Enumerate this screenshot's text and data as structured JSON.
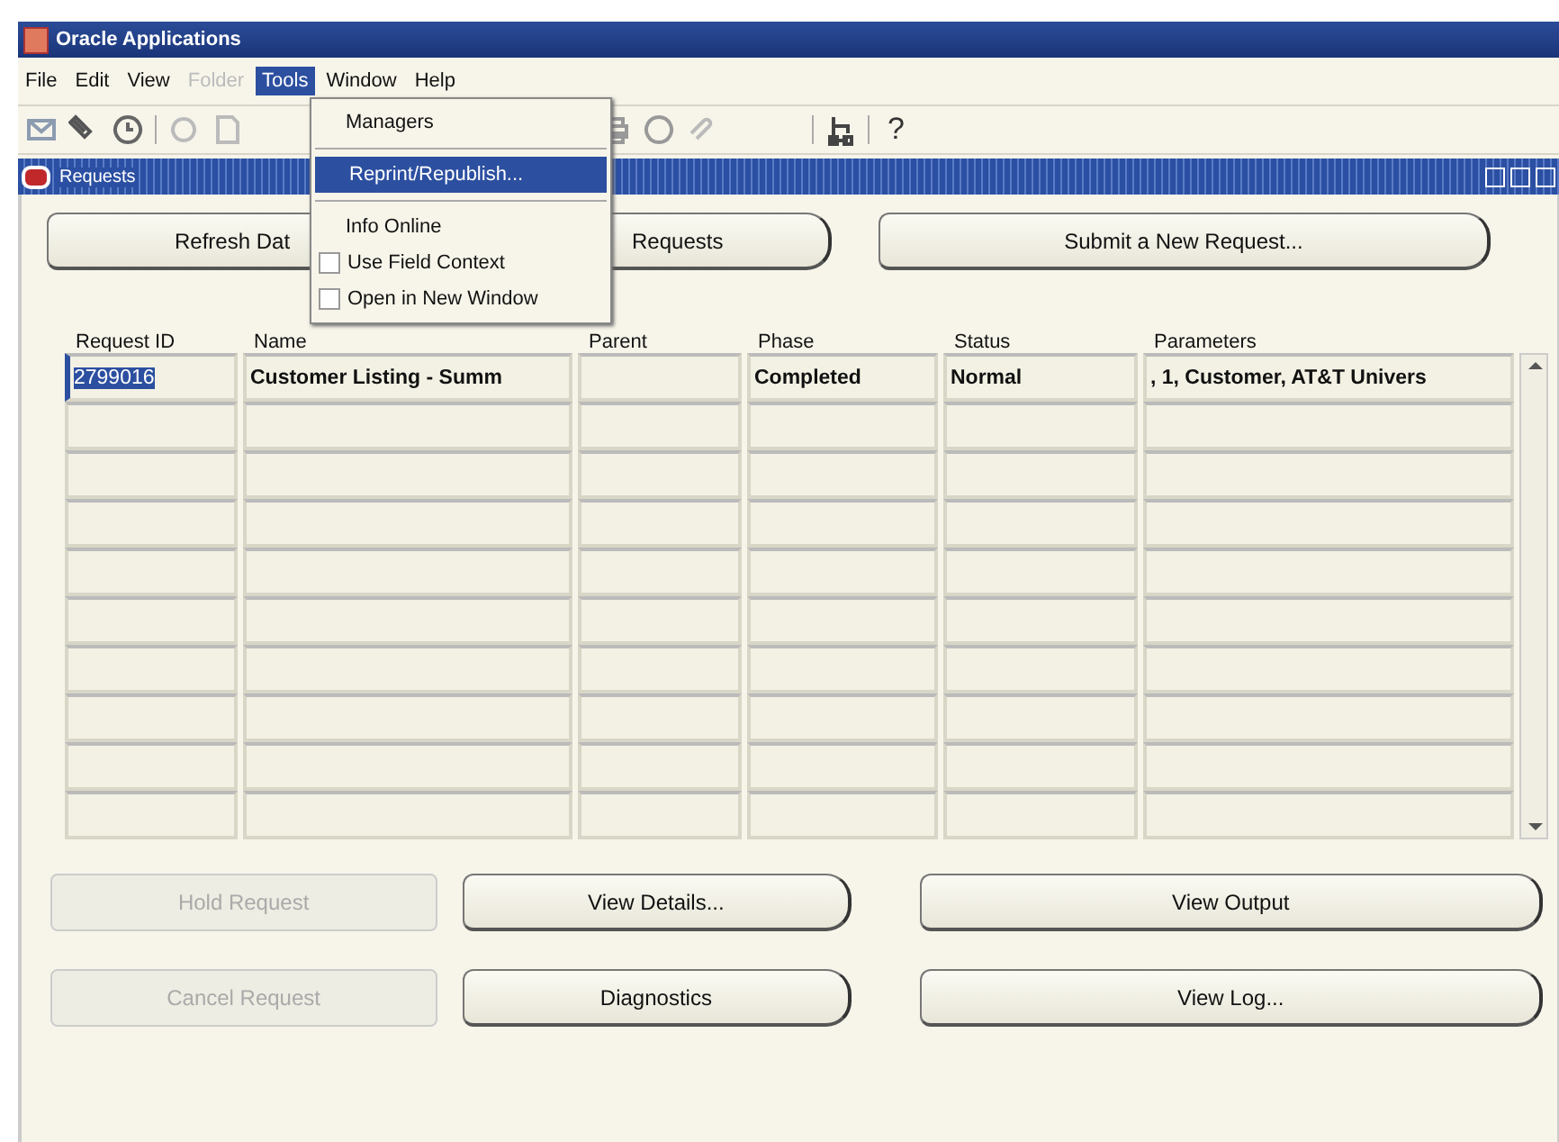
{
  "window": {
    "title": "Oracle Applications"
  },
  "menubar": [
    {
      "label": "File",
      "disabled": false,
      "selected": false
    },
    {
      "label": "Edit",
      "disabled": false,
      "selected": false
    },
    {
      "label": "View",
      "disabled": false,
      "selected": false
    },
    {
      "label": "Folder",
      "disabled": true,
      "selected": false
    },
    {
      "label": "Tools",
      "disabled": false,
      "selected": true
    },
    {
      "label": "Window",
      "disabled": false,
      "selected": false
    },
    {
      "label": "Help",
      "disabled": false,
      "selected": false
    }
  ],
  "tools_menu": {
    "groups": [
      [
        {
          "label": "Managers",
          "kind": "item",
          "selected": false
        }
      ],
      [
        {
          "label": "Reprint/Republish...",
          "kind": "item",
          "selected": true
        }
      ],
      [
        {
          "label": "Info Online",
          "kind": "item",
          "selected": false
        },
        {
          "label": "Use Field Context",
          "kind": "check",
          "checked": false,
          "selected": false
        },
        {
          "label": "Open in New Window",
          "kind": "check",
          "checked": false,
          "selected": false
        }
      ]
    ]
  },
  "toolbar": {
    "help": "?"
  },
  "requests_window": {
    "title": "Requests",
    "top_buttons": [
      {
        "label": "Refresh Dat",
        "disabled": false
      },
      {
        "label": "Requests",
        "disabled": false
      },
      {
        "label": "Submit a New Request...",
        "disabled": false
      }
    ],
    "table": {
      "columns": [
        "Request ID",
        "Name",
        "Parent",
        "Phase",
        "Status",
        "Parameters"
      ],
      "rows": [
        {
          "cells": [
            "2799016",
            "Customer Listing - Summ",
            "",
            "Completed",
            "Normal",
            ", 1, Customer, AT&T Univers"
          ],
          "selected": true
        }
      ]
    },
    "bottom_buttons": [
      [
        {
          "label": "Hold Request",
          "disabled": true
        },
        {
          "label": "View Details...",
          "disabled": false
        },
        {
          "label": "View Output",
          "disabled": false
        }
      ],
      [
        {
          "label": "Cancel Request",
          "disabled": true
        },
        {
          "label": "Diagnostics",
          "disabled": false
        },
        {
          "label": "View Log...",
          "disabled": false
        }
      ]
    ]
  }
}
